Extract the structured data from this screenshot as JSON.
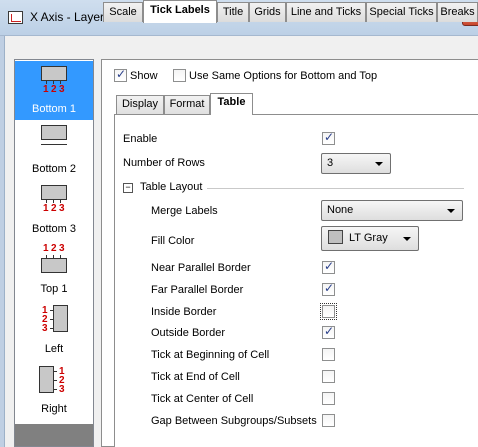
{
  "window": {
    "title": "X Axis - Layer1"
  },
  "icon_list": [
    {
      "label": "Bottom 1"
    },
    {
      "label": "Bottom 2"
    },
    {
      "label": "Bottom 3"
    },
    {
      "label": "Top 1"
    },
    {
      "label": "Left"
    },
    {
      "label": "Right"
    }
  ],
  "icon_numbers": {
    "n1": "1",
    "n2": "2",
    "n3": "3"
  },
  "tabs": [
    "Scale",
    "Tick Labels",
    "Title",
    "Grids",
    "Line and Ticks",
    "Special Ticks",
    "Breaks"
  ],
  "active_tab": "Tick Labels",
  "top_options": {
    "show_label": "Show",
    "show_checked": true,
    "same_options_label": "Use Same Options for Bottom and Top",
    "same_options_checked": false
  },
  "subtabs": [
    "Display",
    "Format",
    "Table"
  ],
  "active_subtab": "Table",
  "table": {
    "enable_label": "Enable",
    "enable_checked": true,
    "rows_label": "Number of Rows",
    "rows_value": "3",
    "layout_label": "Table Layout",
    "layout_toggle": "−",
    "merge_label": "Merge Labels",
    "merge_value": "None",
    "fill_label": "Fill Color",
    "fill_value": "LT Gray",
    "fill_color": "#c0c0c0",
    "options": [
      {
        "label": "Near Parallel Border",
        "checked": true
      },
      {
        "label": "Far Parallel Border",
        "checked": true
      },
      {
        "label": "Inside Border",
        "checked": false
      },
      {
        "label": "Outside Border",
        "checked": true
      },
      {
        "label": "Tick at Beginning of Cell",
        "checked": false
      },
      {
        "label": "Tick at End of Cell",
        "checked": false
      },
      {
        "label": "Tick at Center of Cell",
        "checked": false
      },
      {
        "label": "Gap Between Subgroups/Subsets",
        "checked": false
      }
    ]
  },
  "colors": {
    "selection": "#3399ff",
    "number_red": "#cc0000"
  }
}
